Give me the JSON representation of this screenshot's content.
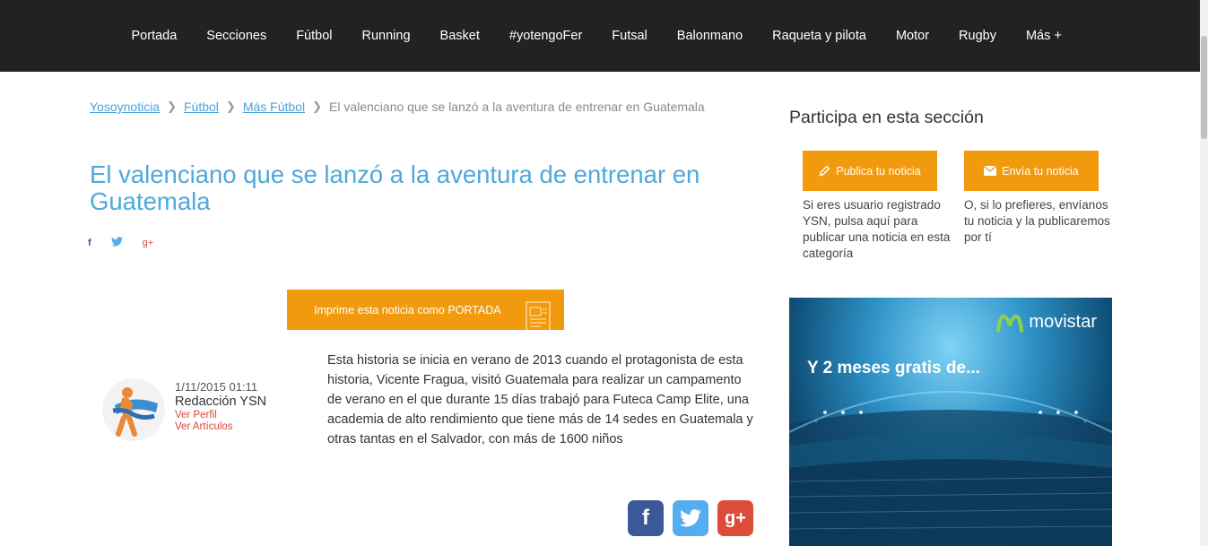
{
  "nav": {
    "items": [
      "Portada",
      "Secciones",
      "Fútbol",
      "Running",
      "Basket",
      "#yotengoFer",
      "Futsal",
      "Balonmano",
      "Raqueta y pilota",
      "Motor",
      "Rugby",
      "Más +"
    ]
  },
  "breadcrumb": {
    "items": [
      "Yosoynoticia",
      "Fútbol",
      "Más Fútbol"
    ],
    "current": "El valenciano que se lanzó a la aventura de entrenar en Guatemala"
  },
  "article": {
    "title": "El valenciano que se lanzó a la aventura de entrenar en Guatemala",
    "print_button": "Imprime esta noticia como PORTADA",
    "date": "1/11/2015 01:11",
    "author": "Redacción YSN",
    "view_profile": "Ver Perfil",
    "view_articles": "Ver Artículos",
    "body": "Esta historia se inicia en verano de 2013 cuando el protagonista de esta historia, Vicente Fragua, visitó Guatemala para realizar un campamento de verano en el que durante 15 días trabajó para Futeca Camp Elite, una academia de alto rendimiento que tiene más de 14 sedes en Guatemala y otras tantas en el Salvador, con más de 1600 niños"
  },
  "social": {
    "facebook": "f",
    "google": "g+",
    "facebook_color": "#3b5998",
    "twitter_color": "#55acee",
    "google_color": "#dd4b39"
  },
  "sidebar": {
    "title": "Participa en esta sección",
    "publish_button": "Publica tu noticia",
    "publish_desc": "Si eres usuario registrado YSN, pulsa aquí para publicar una noticia en esta categoría",
    "send_button": "Envía tu noticia",
    "send_desc": "O, si lo prefieres, envíanos tu noticia y la publicaremos por tí"
  },
  "ad": {
    "brand": "movistar",
    "headline": "Y 2 meses gratis de..."
  },
  "colors": {
    "accent": "#f29a0e",
    "title_blue": "#4ea8dd",
    "nav_bg": "#222224"
  }
}
